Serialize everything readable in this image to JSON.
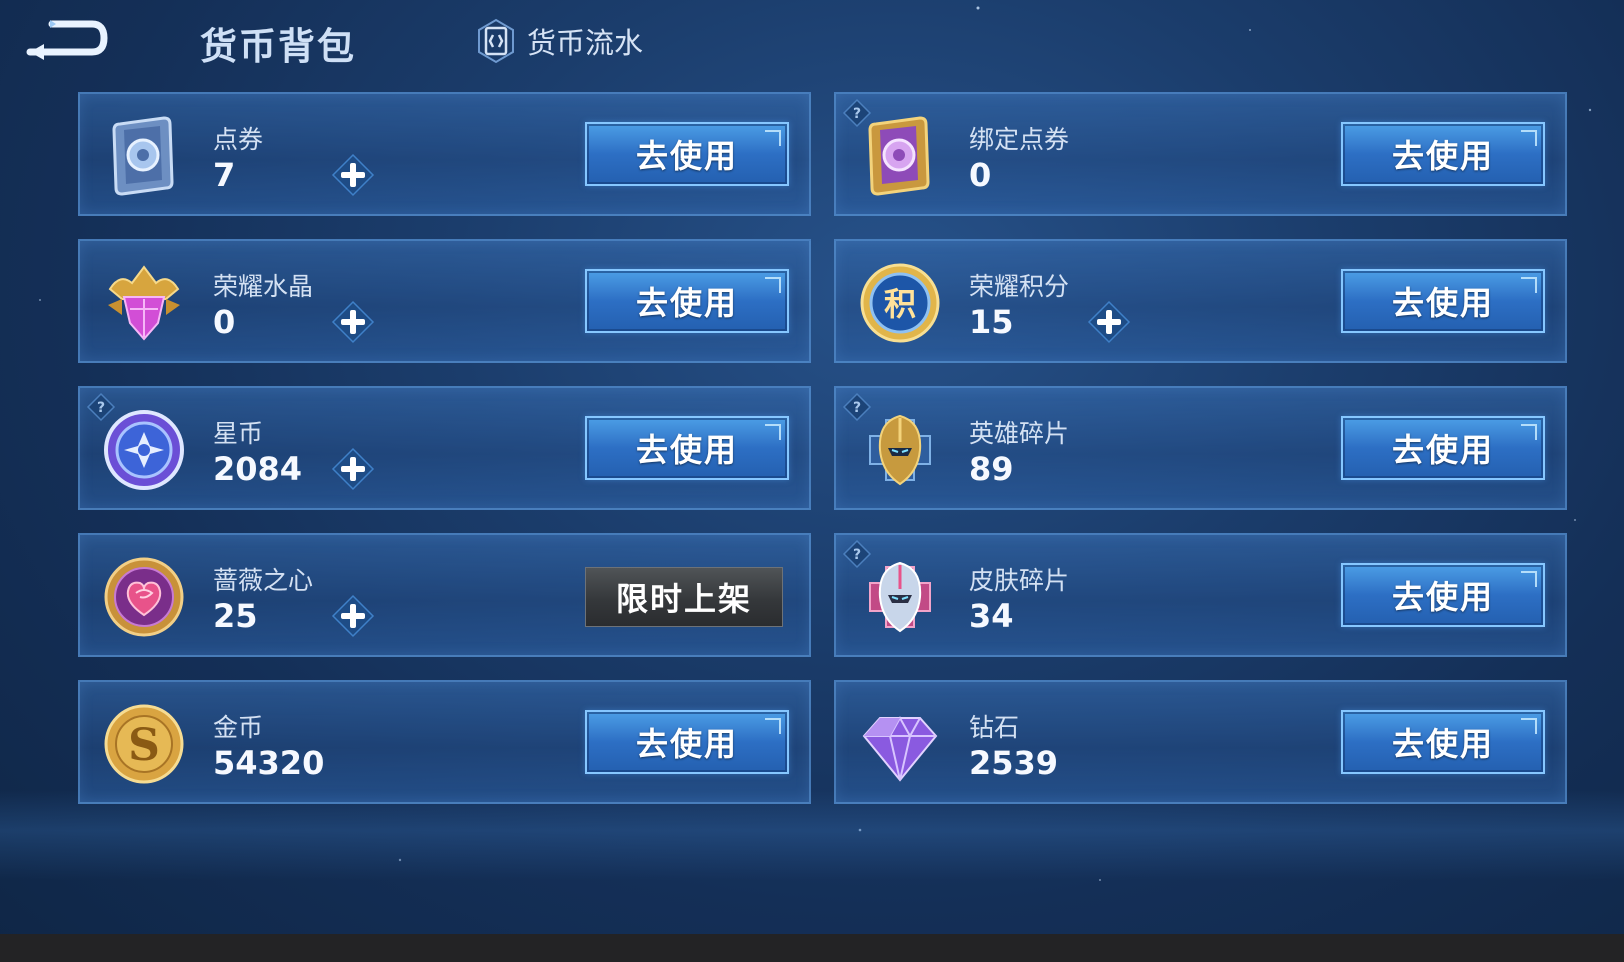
{
  "header": {
    "title": "货币背包",
    "flow_label": "货币流水"
  },
  "currencies": [
    {
      "name": "点券",
      "value": "7",
      "button": "去使用",
      "icon": "coupon-card-icon",
      "has_plus": true,
      "has_help": false
    },
    {
      "name": "绑定点券",
      "value": "0",
      "button": "去使用",
      "icon": "bound-coupon-card-icon",
      "has_plus": false,
      "has_help": true
    },
    {
      "name": "荣耀水晶",
      "value": "0",
      "button": "去使用",
      "icon": "glory-crystal-icon",
      "has_plus": true,
      "has_help": false
    },
    {
      "name": "荣耀积分",
      "value": "15",
      "button": "去使用",
      "icon": "glory-points-icon",
      "icon_text": "积",
      "has_plus": true,
      "has_help": false
    },
    {
      "name": "星币",
      "value": "2084",
      "button": "去使用",
      "icon": "star-coin-icon",
      "has_plus": true,
      "has_help": true
    },
    {
      "name": "英雄碎片",
      "value": "89",
      "button": "去使用",
      "icon": "hero-fragment-icon",
      "has_plus": false,
      "has_help": true
    },
    {
      "name": "蔷薇之心",
      "value": "25",
      "button": "限时上架",
      "button_disabled": true,
      "icon": "rose-heart-icon",
      "has_plus": true,
      "has_help": false
    },
    {
      "name": "皮肤碎片",
      "value": "34",
      "button": "去使用",
      "icon": "skin-fragment-icon",
      "has_plus": false,
      "has_help": true
    },
    {
      "name": "金币",
      "value": "54320",
      "button": "去使用",
      "icon": "gold-coin-icon",
      "icon_text": "S",
      "has_plus": false,
      "has_help": false
    },
    {
      "name": "钻石",
      "value": "2539",
      "button": "去使用",
      "icon": "diamond-icon",
      "has_plus": false,
      "has_help": false
    }
  ],
  "colors": {
    "background": "#1b3d6c",
    "use_button": "#2d6fc4",
    "limited_button": "#35383b",
    "plus_icon": "#3f9be8"
  }
}
